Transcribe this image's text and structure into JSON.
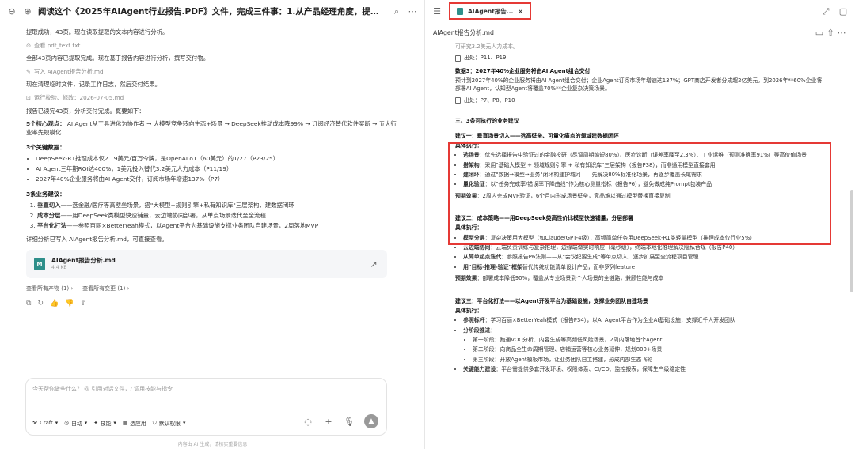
{
  "left": {
    "title": "阅读这个《2025年AIAgent行业报告.PDF》文件，完成三件事：1.从产品经理角度，提炼出5...",
    "tools": [
      {
        "icon": "view-icon",
        "label": "查看 pdf_text.txt"
      },
      {
        "icon": "write-icon",
        "label": "写入 AIAgent报告分析.md"
      },
      {
        "icon": "run-icon",
        "label": "运行校验、修改：2026-07-05.md"
      }
    ],
    "chat": {
      "p1": "提取成功，43页。现在读取提取的文本内容进行分析。",
      "p2": "全部43页内容已提取完成。现在基于报告内容进行分析，撰写交付物。",
      "p3": "现在清理临时文件，记录工作日志，然后交付结果。",
      "p4": "报告已读完43页，分析交付完成。概要如下：",
      "sec1_title": "5个核心观点：",
      "sec1_text": "AI Agent从工具进化为协作者 → 大模型竞争转向生态+场景 → DeepSeek推动成本降99% → 订阅经济替代软件买断 → 五大行业率先规模化",
      "sec2_title": "3个关键数据：",
      "sec2_items": [
        "DeepSeek-R1推理成本仅2.19美元/百万令牌，是OpenAI o1（60美元）的1/27（P23/25）",
        "AI Agent三年期ROI达400%，1美元投入替代3.2美元人力成本（P11/19）",
        "2027年40%企业服务将由AI Agent交付，订阅市场年增速137%（P7）"
      ],
      "sec3_title": "3条业务建议：",
      "sec3_items": [
        {
          "b": "垂直切入",
          "t": "——选金融/医疗等高壁垒场景，搭\"大模型+规则引擎+私有知识库\"三层架构，建数据闭环"
        },
        {
          "b": "成本分层",
          "t": "——用DeepSeek类模型快速铺量，云边端协同部署，从单点场景迭代至全流程"
        },
        {
          "b": "平台化打法",
          "t": "——参照百丽×BetterYeah模式，以Agent平台为基础设施支撑业务团队自建场景，2周落地MVP"
        }
      ],
      "p5": "详细分析已写入 AIAgent报告分析.md，可直接查看。"
    },
    "file": {
      "name": "AIAgent报告分析.md",
      "size": "4.4 KB"
    },
    "links": [
      "查看所有产物 (1) ›",
      "查看所有变更 (1) ›"
    ],
    "input": {
      "placeholder": "今天帮你做些什么？ @ 引用对话文件，/ 调用技能与指令",
      "toolbar": [
        "Craft",
        "自动",
        "技能",
        "选应用",
        "默认权限"
      ]
    },
    "footer": "内容由 AI 生成，请核实重要信息"
  },
  "right": {
    "tab_label": "AIAgent报告...",
    "file_title": "AIAgent报告分析.md",
    "doc": {
      "top_line": "可研究3.2美元人力成本。",
      "src1": "出处：P11、P19",
      "d3_title": "数据3：2027年40%企业服务将由AI Agent组合交付",
      "d3_text": "预计到2027年40%的企业服务将由AI Agent组合交付；企业Agent订阅市场年增速达137%；GPT商店开发者分成超2亿美元。到2026年**60%企业将部署AI Agent，认知型Agent将覆盖70%**企业复杂决策场景。",
      "src2": "出处：P7、P8、P10",
      "s3_title": "三、3条可执行的业务建议",
      "b1_title": "建议一：垂直场景切入——选高壁垒、可量化痛点的领域建数据闭环",
      "b1_path": "具体执行：",
      "b1_items": [
        {
          "b": "选场景",
          "t": "：优先选择报告中验证过的金融投研（尽调周期缩短80%）、医疗诊断（误差率降至2.3%）、工业运维（预测准确率91%）等高价值场景"
        },
        {
          "b": "搭架构",
          "t": "：采用\"基础大模型 + 领域规则引擎 + 私有知识库\"三层架构（报告P38），而非通用模型直接套用"
        },
        {
          "b": "建闭环",
          "t": "：通过\"数据→模型→业务\"闭环构建护城河——先解决80%标准化场景，再逐步覆盖长尾需求"
        },
        {
          "b": "量化验证",
          "t": "：以\"任务完成率/错误率下降曲线\"作为核心测量指标（报告P6），避免做成纯Prompt包装产品"
        }
      ],
      "b1_effect_b": "预期效果",
      "b1_effect": "：2周内完成MVP验证，6个月内形成场景壁垒，竞品难以通过模型替换直接复制",
      "b2_title": "建议二：成本策略——用DeepSeek类高性价比模型快速铺量，分层部署",
      "b2_path": "具体执行：",
      "b2_items": [
        {
          "b": "模型分层",
          "t": "：复杂决策用大模型（如Claude/GPT-4级），高频简单任务用DeepSeek-R1类轻量模型（推理成本仅行业5%）"
        },
        {
          "b": "云边端协同",
          "t": "：云端负责训练与复杂推理，边缘端做实时响应（毫秒级），终端本地化推理解决隐私合规（报告P40）"
        },
        {
          "b": "从简单起点迭代",
          "t": "：参照报告P6法则——从\"会议纪要生成\"等单点切入，逐步扩展至全流程项目管理"
        },
        {
          "b": "用\"目标-推理-验证\"框架",
          "t": "替代传统功能清单设计产品，而非罗列feature"
        }
      ],
      "b2_effect_b": "预期效果",
      "b2_effect": "：部署成本降低90%，覆盖从专业场景到个人场景的全链路，兼顾性能与成本",
      "b3_title": "建议三：平台化打法——以Agent开发平台为基础设施，支撑业务团队自建场景",
      "b3_path": "具体执行：",
      "b3_i1_b": "参照标杆",
      "b3_i1": "：学习百丽×BetterYeah模式（报告P34），以AI Agent平台作为企业AI基础设施，支撑近千人开发团队",
      "b3_i2_b": "分阶段推进",
      "b3_sub": [
        "第一阶段：跑通VOC分析、内容生成等高频低风险场景，2周内落地首个Agent",
        "第二阶段：向商品全生命周期管理、店铺运营等核心业务延伸，规划800+场景",
        "第三阶段：开放Agent模板市场，让业务团队自主搭建，形成内部生态飞轮"
      ],
      "b3_i3_b": "关键能力建设",
      "b3_i3": "：平台需提供多套开发环境、权限体系、CI/CD、监控报表，保障生产级稳定性"
    }
  }
}
